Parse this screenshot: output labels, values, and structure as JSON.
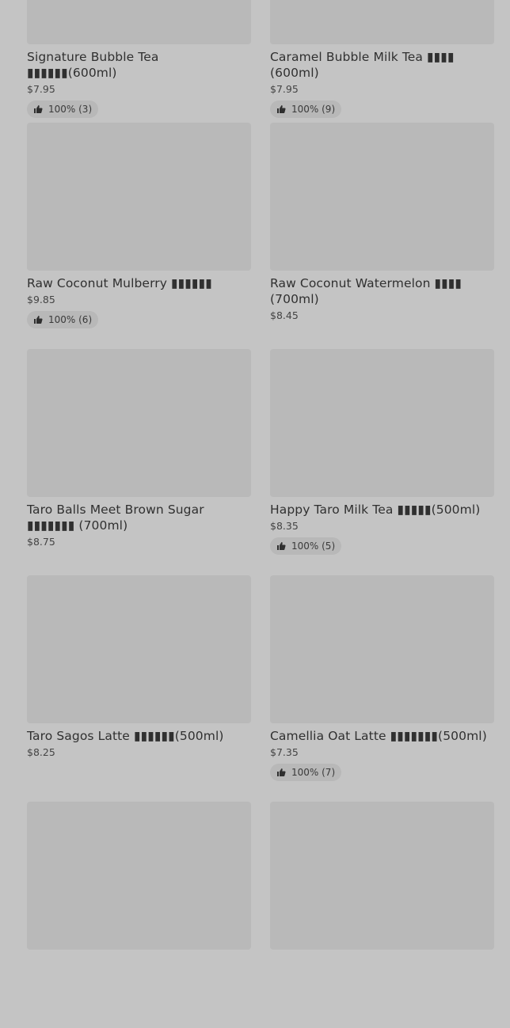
{
  "items": [
    {
      "name": "Signature Bubble Tea ▮▮▮▮▮▮(600ml)",
      "price": "$7.95",
      "rating": "100% (3)"
    },
    {
      "name": "Caramel Bubble Milk Tea ▮▮▮▮ (600ml)",
      "price": "$7.95",
      "rating": "100% (9)"
    },
    {
      "name": "Raw Coconut Mulberry ▮▮▮▮▮▮",
      "price": "$9.85",
      "rating": "100% (6)"
    },
    {
      "name": "Raw Coconut Watermelon ▮▮▮▮ (700ml)",
      "price": "$8.45",
      "rating": ""
    },
    {
      "name": "Taro Balls Meet Brown Sugar ▮▮▮▮▮▮▮ (700ml)",
      "price": "$8.75",
      "rating": ""
    },
    {
      "name": "Happy Taro Milk Tea ▮▮▮▮▮(500ml)",
      "price": "$8.35",
      "rating": "100% (5)"
    },
    {
      "name": "Taro Sagos Latte ▮▮▮▮▮▮(500ml)",
      "price": "$8.25",
      "rating": ""
    },
    {
      "name": "Camellia Oat Latte ▮▮▮▮▮▮▮(500ml)",
      "price": "$7.35",
      "rating": "100% (7)"
    },
    {
      "name": "",
      "price": "",
      "rating": ""
    },
    {
      "name": "",
      "price": "",
      "rating": ""
    }
  ]
}
